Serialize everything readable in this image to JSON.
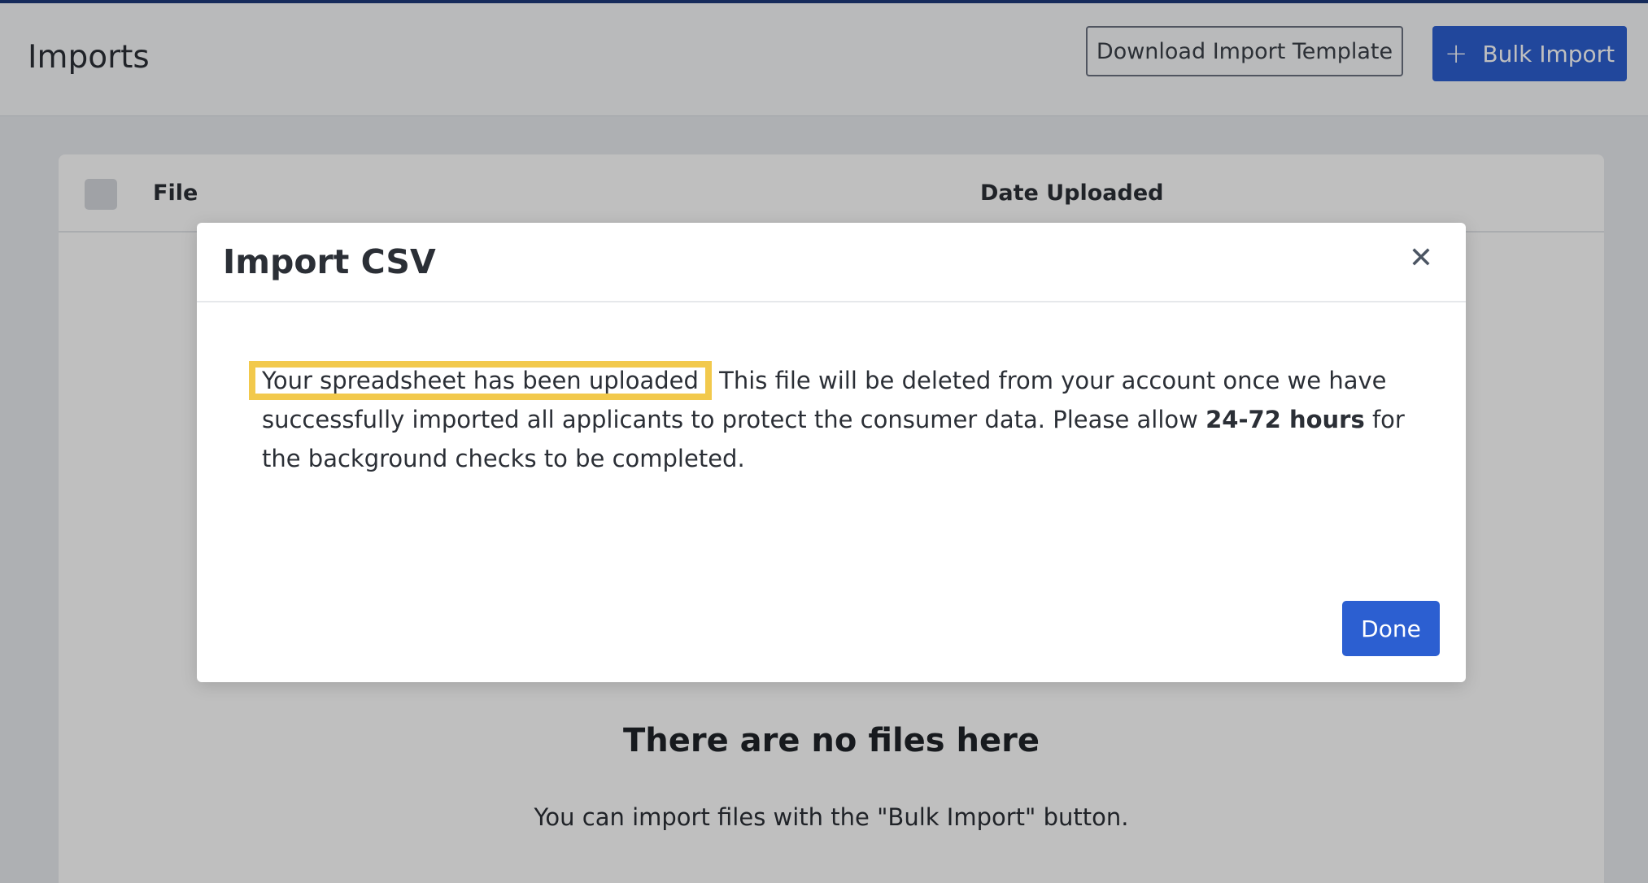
{
  "header": {
    "title": "Imports",
    "download_template_label": "Download Import Template",
    "bulk_import_label": "Bulk Import",
    "plus_glyph": "+"
  },
  "table": {
    "columns": [
      "File",
      "Date Uploaded"
    ],
    "empty_title": "There are no files here",
    "empty_subtitle": "You can import files with the \"Bulk Import\" button."
  },
  "modal": {
    "title": "Import CSV",
    "close_glyph": "✕",
    "highlight_text": "Your spreadsheet has been uploaded",
    "body_text_1": " This file will be deleted from your account once we have successfully imported all applicants to protect the consumer data. Please allow ",
    "body_bold": "24-72 hours",
    "body_text_2": " for the background checks to be completed.",
    "done_label": "Done"
  },
  "colors": {
    "accent": "#2c5fd1",
    "top_bar": "#1e3a7a",
    "highlight_border": "#f2c94c"
  }
}
